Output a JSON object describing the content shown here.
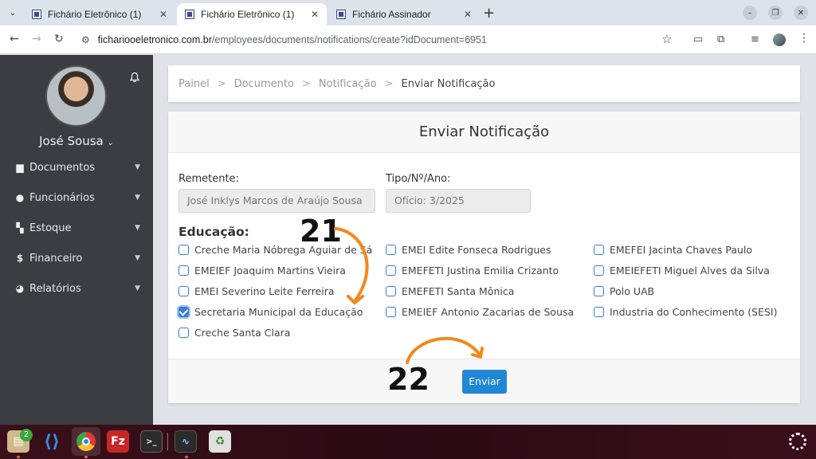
{
  "browser": {
    "tabs": [
      {
        "title": "Fichário Eletrônico (1)"
      },
      {
        "title": "Fichário Eletrônico (1)"
      },
      {
        "title": "Fichário Assinador"
      }
    ],
    "url_domain": "fichariooeletronico.com.br",
    "url_path": "/employees/documents/notifications/create?idDocument=6951"
  },
  "sidebar": {
    "user_name": "José Sousa",
    "items": [
      {
        "label": "Documentos",
        "icon": "document-icon"
      },
      {
        "label": "Funcionários",
        "icon": "user-icon"
      },
      {
        "label": "Estoque",
        "icon": "boxes-icon"
      },
      {
        "label": "Financeiro",
        "icon": "dollar-icon"
      },
      {
        "label": "Relatórios",
        "icon": "pie-chart-icon"
      }
    ]
  },
  "breadcrumb": [
    "Painel",
    "Documento",
    "Notificação",
    "Enviar Notificação"
  ],
  "form": {
    "title": "Enviar Notificação",
    "sender_label": "Remetente:",
    "sender_value": "José Inklys Marcos de Araújo Sousa",
    "type_label": "Tipo/Nº/Ano:",
    "type_value": "Ofício: 3/2025",
    "section_title": "Educação:",
    "recipients": [
      {
        "label": "Creche Maria Nóbrega Aguiar de Sá",
        "checked": false
      },
      {
        "label": "EMEIEF Joaquim Martins Vieira",
        "checked": false
      },
      {
        "label": "EMEI Severino Leite Ferreira",
        "checked": false
      },
      {
        "label": "Secretaria Municipal da Educação",
        "checked": true
      },
      {
        "label": "Creche Santa Clara",
        "checked": false
      },
      {
        "label": "EMEI Edite Fonseca Rodrigues",
        "checked": false
      },
      {
        "label": "EMEFETI Justina Emilia Crizanto",
        "checked": false
      },
      {
        "label": "EMEFETI Santa Mônica",
        "checked": false
      },
      {
        "label": "EMEIEF Antonio Zacarias de Sousa",
        "checked": false
      },
      {
        "label": "EMEFEI Jacinta Chaves Paulo",
        "checked": false
      },
      {
        "label": "EMEIEFETI Miguel Alves da Silva",
        "checked": false
      },
      {
        "label": "Polo UAB",
        "checked": false
      },
      {
        "label": "Industria do Conhecimento (SESI)",
        "checked": false
      }
    ],
    "send_label": "Enviar"
  },
  "annotations": {
    "step_a": "21",
    "step_b": "22"
  },
  "taskbar": {
    "badge": "2"
  },
  "colors": {
    "accent": "#1f87d6",
    "sidebar": "#3b3d40",
    "checkbox": "#3a7bd5",
    "annotation_arrow": "#f08a1c"
  }
}
